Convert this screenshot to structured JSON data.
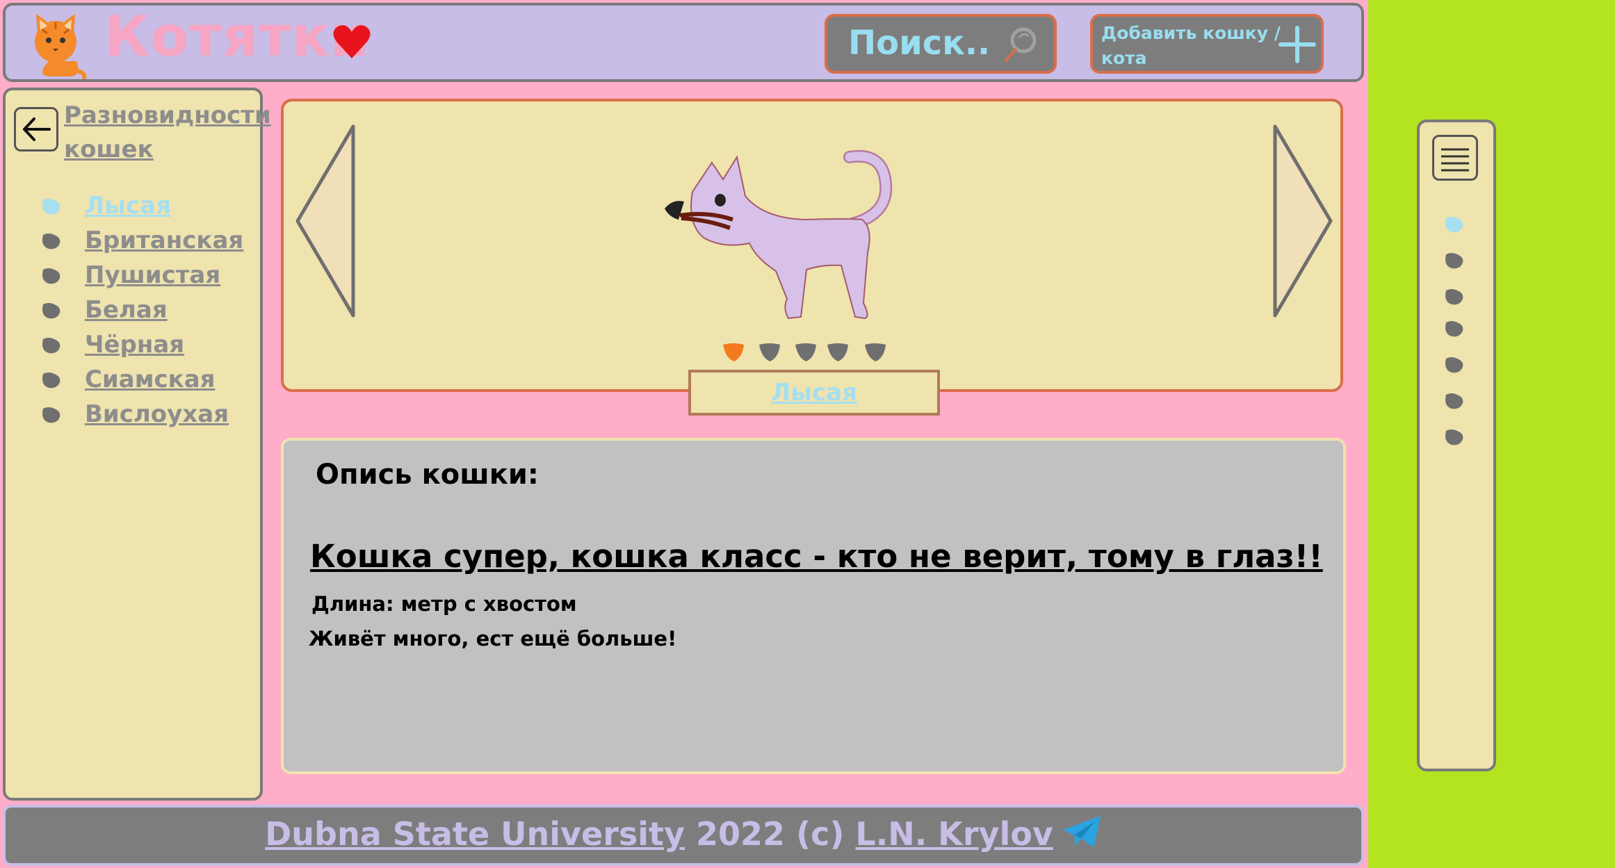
{
  "header": {
    "title": "Котятки",
    "search_placeholder": "Поиск..",
    "add_label": "Добавить кошку / кота"
  },
  "sidebar": {
    "title": "Разновидности кошек",
    "items": [
      {
        "label": "Лысая",
        "active": true
      },
      {
        "label": "Британская",
        "active": false
      },
      {
        "label": "Пушистая",
        "active": false
      },
      {
        "label": "Белая",
        "active": false
      },
      {
        "label": "Чёрная",
        "active": false
      },
      {
        "label": "Сиамская",
        "active": false
      },
      {
        "label": "Вислоухая",
        "active": false
      }
    ]
  },
  "carousel": {
    "caption": "Лысая",
    "slide_count": 5,
    "current_slide": 1
  },
  "description": {
    "heading": "Опись кошки:",
    "main": "Кошка супер, кошка класс - кто не верит, тому в глаз!!",
    "line1": "Длина: метр с хвостом",
    "line2": "Живёт много, ест ещё больше!"
  },
  "footer": {
    "university": "Dubna State University",
    "middle": " 2022 (c) ",
    "author": "L.N. Krylov"
  },
  "colors": {
    "page_bg": "#ffadc9",
    "outside_bg": "#b4e41f",
    "header_bg": "#c7bde6",
    "panel_bg": "#efe3ae",
    "accent_border": "#d96e4a",
    "active_link": "#a5dff0",
    "inactive_link": "#8d8d8d",
    "active_dot": "#f47a1f"
  }
}
